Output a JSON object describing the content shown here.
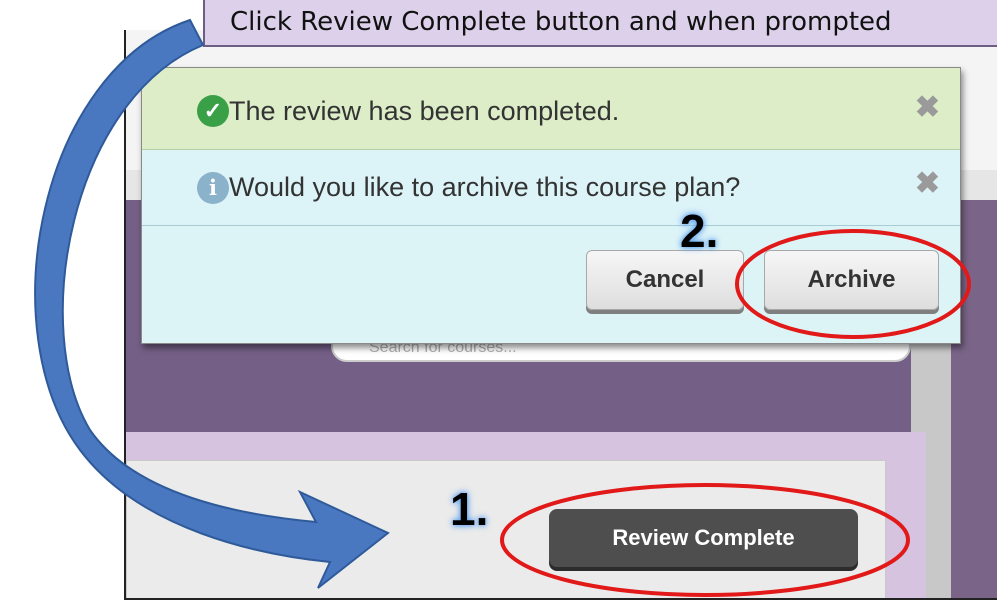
{
  "instruction": {
    "text": "Click Review Complete button and when prompted"
  },
  "background": {
    "search_placeholder": "Search for courses...",
    "review_complete_label": "Review Complete"
  },
  "dialog": {
    "success_message": "The review has been completed.",
    "info_message": "Would you like to archive this course plan?",
    "cancel_label": "Cancel",
    "archive_label": "Archive",
    "close_glyph": "✖"
  },
  "icons": {
    "success": "check-circle-icon",
    "info": "info-circle-icon",
    "close": "close-icon"
  },
  "steps": {
    "step_1": "1.",
    "step_2": "2."
  },
  "colors": {
    "instruction_bg": "#dcd0ea",
    "success_bg": "#dcedc8",
    "info_bg": "#dcf3f8",
    "highlight_ring": "#e11919",
    "arrow": "#4a78c0",
    "purple_band": "#745f86"
  }
}
